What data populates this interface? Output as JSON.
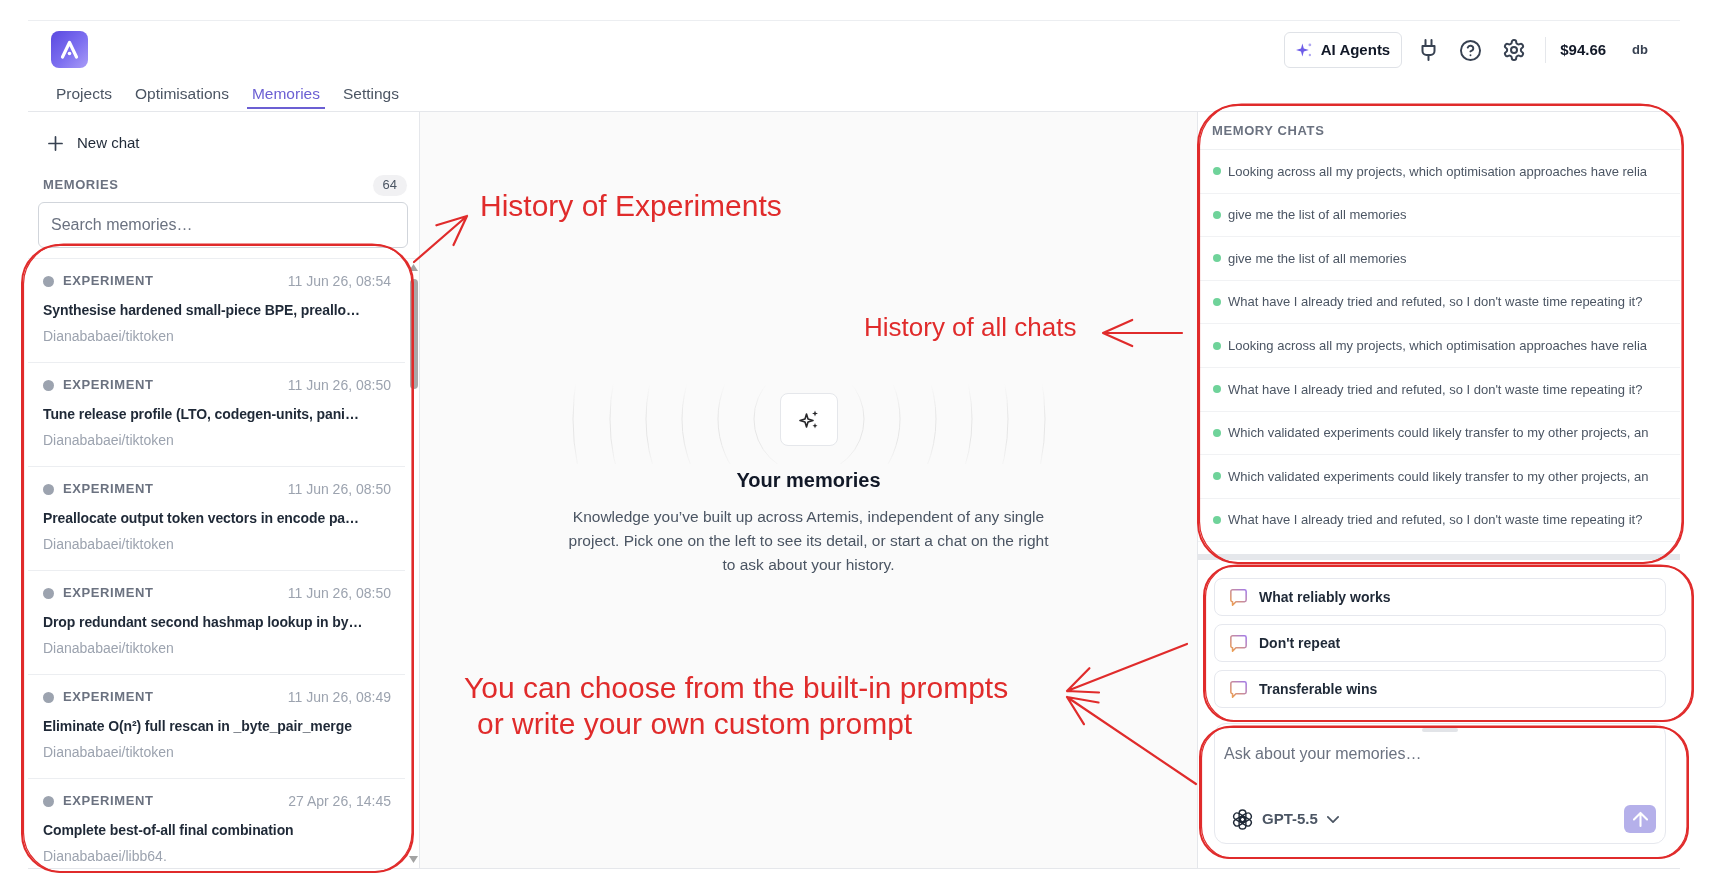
{
  "header": {
    "tabs": [
      {
        "label": "Projects",
        "selected": false
      },
      {
        "label": "Optimisations",
        "selected": false
      },
      {
        "label": "Memories",
        "selected": true
      },
      {
        "label": "Settings",
        "selected": false
      }
    ],
    "agents_button": "AI Agents",
    "balance": "$94.66",
    "user": "db"
  },
  "sidebar": {
    "new_chat": "New chat",
    "section_label": "MEMORIES",
    "count": "64",
    "search": {
      "placeholder": "Search memories…"
    },
    "items": [
      {
        "category": "EXPERIMENT",
        "date": "11 Jun 26, 08:54",
        "title": "Synthesise hardened small-piece BPE, preallo…",
        "repo": "Dianababaei/tiktoken"
      },
      {
        "category": "EXPERIMENT",
        "date": "11 Jun 26, 08:50",
        "title": "Tune release profile (LTO, codegen-units, pani…",
        "repo": "Dianababaei/tiktoken"
      },
      {
        "category": "EXPERIMENT",
        "date": "11 Jun 26, 08:50",
        "title": "Preallocate output token vectors in encode pa…",
        "repo": "Dianababaei/tiktoken"
      },
      {
        "category": "EXPERIMENT",
        "date": "11 Jun 26, 08:50",
        "title": "Drop redundant second hashmap lookup in by…",
        "repo": "Dianababaei/tiktoken"
      },
      {
        "category": "EXPERIMENT",
        "date": "11 Jun 26, 08:49",
        "title": "Eliminate O(n²) full rescan in _byte_pair_merge",
        "repo": "Dianababaei/tiktoken"
      },
      {
        "category": "EXPERIMENT",
        "date": "27 Apr 26, 14:45",
        "title": "Complete best-of-all final combination",
        "repo": "Dianababaei/libb64."
      }
    ]
  },
  "empty_state": {
    "title": "Your memories",
    "description": "Knowledge you’ve built up across Artemis, independent of any single project. Pick one on the left to see its detail, or start a chat on the right to ask about your history."
  },
  "memory_chats": {
    "heading": "MEMORY CHATS",
    "items": [
      {
        "text": "Looking across all my projects, which optimisation approaches have relia"
      },
      {
        "text": "give me the list of all memories"
      },
      {
        "text": "give me the list of all memories"
      },
      {
        "text": "What have I already tried and refuted, so I don't waste time repeating it?"
      },
      {
        "text": "Looking across all my projects, which optimisation approaches have relia"
      },
      {
        "text": "What have I already tried and refuted, so I don't waste time repeating it?"
      },
      {
        "text": "Which validated experiments could likely transfer to my other projects, an"
      },
      {
        "text": "Which validated experiments could likely transfer to my other projects, an"
      },
      {
        "text": "What have I already tried and refuted, so I don't waste time repeating it?"
      }
    ]
  },
  "prompts": [
    {
      "label": "What reliably works"
    },
    {
      "label": "Don't repeat"
    },
    {
      "label": "Transferable wins"
    }
  ],
  "composer": {
    "placeholder": "Ask about your memories…",
    "model": "GPT-5.5"
  },
  "annotations": [
    {
      "text": "History of Experiments"
    },
    {
      "text": "History of all chats"
    },
    {
      "text": "You can choose from the built-in prompts\nor write your own custom prompt"
    }
  ]
}
